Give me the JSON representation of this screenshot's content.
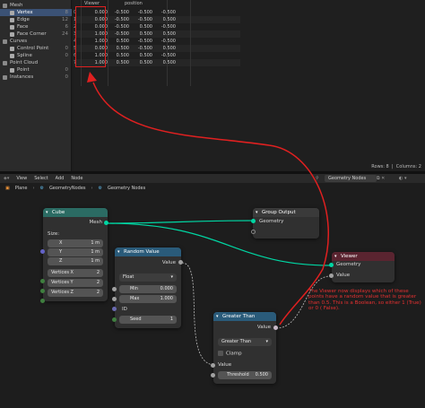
{
  "outliner": {
    "items": [
      {
        "label": "Mesh",
        "count": "",
        "indent": 0,
        "selected": false,
        "color": "#8a8a8a"
      },
      {
        "label": "Vertex",
        "count": "8",
        "indent": 1,
        "selected": true,
        "color": "#aaaaaa"
      },
      {
        "label": "Edge",
        "count": "12",
        "indent": 1,
        "selected": false,
        "color": "#aaaaaa"
      },
      {
        "label": "Face",
        "count": "6",
        "indent": 1,
        "selected": false,
        "color": "#aaaaaa"
      },
      {
        "label": "Face Corner",
        "count": "24",
        "indent": 1,
        "selected": false,
        "color": "#aaaaaa"
      },
      {
        "label": "Curves",
        "count": "",
        "indent": 0,
        "selected": false,
        "color": "#8a8a8a"
      },
      {
        "label": "Control Point",
        "count": "0",
        "indent": 1,
        "selected": false,
        "color": "#aaaaaa"
      },
      {
        "label": "Spline",
        "count": "0",
        "indent": 1,
        "selected": false,
        "color": "#aaaaaa"
      },
      {
        "label": "Point Cloud",
        "count": "",
        "indent": 0,
        "selected": false,
        "color": "#8a8a8a"
      },
      {
        "label": "Point",
        "count": "0",
        "indent": 1,
        "selected": false,
        "color": "#aaaaaa"
      },
      {
        "label": "Instances",
        "count": "0",
        "indent": 0,
        "selected": false,
        "color": "#8a8a8a"
      }
    ]
  },
  "spreadsheet": {
    "columns": [
      "Viewer",
      "position"
    ],
    "rows": [
      [
        "0",
        "0.000",
        "-0.500",
        "-0.500",
        "-0.500"
      ],
      [
        "1",
        "0.000",
        "-0.500",
        "-0.500",
        "0.500"
      ],
      [
        "2",
        "0.000",
        "-0.500",
        "0.500",
        "-0.500"
      ],
      [
        "3",
        "1.000",
        "-0.500",
        "0.500",
        "0.500"
      ],
      [
        "4",
        "1.000",
        "0.500",
        "-0.500",
        "-0.500"
      ],
      [
        "5",
        "0.000",
        "0.500",
        "-0.500",
        "0.500"
      ],
      [
        "6",
        "1.000",
        "0.500",
        "0.500",
        "-0.500"
      ],
      [
        "7",
        "1.000",
        "0.500",
        "0.500",
        "0.500"
      ]
    ],
    "footer": {
      "rows": "Rows: 8",
      "columns": "Columns: 2"
    }
  },
  "node_editor": {
    "menu": [
      "View",
      "Select",
      "Add",
      "Node"
    ],
    "tree_name": "Geometry Nodes",
    "breadcrumb": [
      "Plane",
      "GeometryNodes",
      "Geometry Nodes"
    ]
  },
  "nodes": {
    "cube": {
      "title": "Cube",
      "out_mesh": "Mesh",
      "size_label": "Size:",
      "x_label": "X",
      "x_val": "1 m",
      "y_label": "Y",
      "y_val": "1 m",
      "z_label": "Z",
      "z_val": "1 m",
      "vx": "Vertices X",
      "vx_val": "2",
      "vy": "Vertices Y",
      "vy_val": "2",
      "vz": "Vertices Z",
      "vz_val": "2"
    },
    "group_output": {
      "title": "Group Output",
      "in_geometry": "Geometry"
    },
    "random_value": {
      "title": "Random Value",
      "out_value": "Value",
      "type": "Float",
      "min_label": "Min",
      "min_val": "0.000",
      "max_label": "Max",
      "max_val": "1.000",
      "id_label": "ID",
      "seed_label": "Seed",
      "seed_val": "1"
    },
    "viewer": {
      "title": "Viewer",
      "in_geometry": "Geometry",
      "in_value": "Value"
    },
    "greater_than": {
      "title": "Greater Than",
      "out_value": "Value",
      "mode": "Greater Than",
      "clamp": "Clamp",
      "in_value": "Value",
      "threshold_label": "Threshold",
      "threshold_val": "0.500"
    }
  },
  "annotation": "The Viewer now displays which of these points have a random value that is greater than 0.5. This is a Boolean, so either 1 (True) or 0 ( False).",
  "colors": {
    "annotation": "#e53030",
    "geometry_socket": "#00d6a3",
    "float_socket": "#a1a1a1",
    "cube_header": "#2b6b63",
    "random_header": "#2a5b7a",
    "viewer_header": "#5a2430",
    "greater_header": "#2a5b7a"
  }
}
